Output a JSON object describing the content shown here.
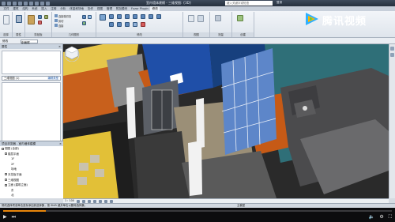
{
  "app": {
    "title": "室内墙体建模 - 三维视图: {3D}",
    "search_placeholder": "键入关键字或短语",
    "sign_in": "登录"
  },
  "ribbon": {
    "tabs": [
      "文件",
      "建筑",
      "结构",
      "系统",
      "插入",
      "注释",
      "分析",
      "体量和场地",
      "协作",
      "视图",
      "管理",
      "附加模块",
      "Fuzor Plugin",
      "修改"
    ],
    "active_tab": "修改",
    "groups": [
      {
        "label": "选择"
      },
      {
        "label": "属性"
      },
      {
        "label": "剪贴板"
      },
      {
        "label": "几何图形"
      },
      {
        "label": "修改"
      },
      {
        "label": "视图"
      },
      {
        "label": "测量"
      },
      {
        "label": "创建"
      }
    ],
    "small_buttons": [
      "连接端切割",
      "剪切",
      "连接"
    ]
  },
  "options_bar": {
    "label": "修改",
    "dropdown_value": "剖面框"
  },
  "properties": {
    "header": "属性",
    "type_selector_value": "三维视图 (1)",
    "edit_type": "编辑类型",
    "help_link": "属性帮助",
    "apply_button": "应用"
  },
  "project_browser": {
    "header": "项目浏览器 - 室内墙体建模",
    "items": [
      {
        "label": "视图 (全部)",
        "indent": 0
      },
      {
        "label": "楼层平面",
        "indent": 1
      },
      {
        "label": "1F",
        "indent": 2
      },
      {
        "label": "2F",
        "indent": 2
      },
      {
        "label": "场地",
        "indent": 2
      },
      {
        "label": "天花板平面",
        "indent": 1
      },
      {
        "label": "三维视图",
        "indent": 1
      },
      {
        "label": "立面 (建筑立面)",
        "indent": 1
      },
      {
        "label": "东",
        "indent": 2
      },
      {
        "label": "北",
        "indent": 2
      },
      {
        "label": "南",
        "indent": 2
      }
    ]
  },
  "view_control": {
    "scale": "1 : 100"
  },
  "status_bar": {
    "text": "修改选择项或单击鼠标添加到选择集，按 Shift 键并单击以删除选择集。",
    "model": "主模型"
  },
  "player": {
    "progress": 0.11,
    "logo_text": "腾讯视频"
  },
  "colors": {
    "floor_orange": "#c55a16",
    "floor_yellow": "#e8c13a",
    "floor_blue": "#1f4fa8",
    "wall_teal": "#2f6f78",
    "accent_orange": "#e8860b"
  }
}
